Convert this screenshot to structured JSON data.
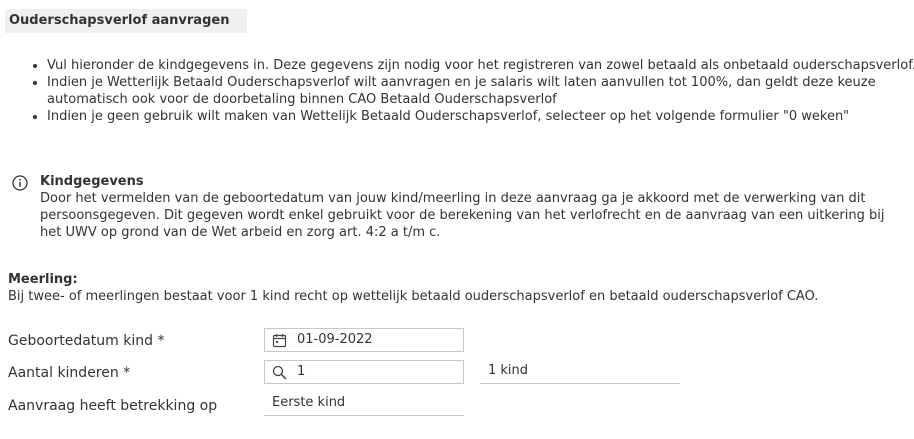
{
  "page": {
    "title": "Ouderschapsverlof aanvragen"
  },
  "intro": {
    "bullets": [
      "Vul hieronder de kindgegevens in. Deze gegevens zijn nodig voor het registreren van zowel betaald als onbetaald ouderschapsverlof.",
      "Indien je Wetterlijk Betaald Ouderschapsverlof wilt aanvragen en je salaris wilt laten aanvullen tot 100%, dan geldt deze keuze automatisch ook voor de doorbetaling binnen CAO Betaald Ouderschapsverlof",
      "Indien je geen gebruik wilt maken van Wettelijk Betaald Ouderschapsverlof, selecteer op het volgende formulier \"0 weken\""
    ]
  },
  "info": {
    "icon": "info-circle-icon",
    "title": "Kindgegevens",
    "text": "Door het vermelden van de geboortedatum van jouw kind/meerling in deze aanvraag ga je akkoord met de verwerking van dit persoonsgegeven. Dit gegeven wordt enkel gebruikt voor de berekening van het verlofrecht en de aanvraag van een uitkering bij het UWV op grond van de Wet arbeid en zorg art. 4:2 a t/m c."
  },
  "meerling": {
    "title": "Meerling:",
    "text": "Bij twee- of meerlingen bestaat voor 1 kind recht op wettelijk betaald ouderschapsverlof en betaald ouderschapsverlof CAO."
  },
  "form": {
    "birthdate": {
      "label": "Geboortedatum kind *",
      "value": "01-09-2022",
      "icon": "calendar-icon"
    },
    "children": {
      "label": "Aantal kinderen *",
      "value": "1",
      "icon": "search-icon",
      "description": "1 kind"
    },
    "relates_to": {
      "label": "Aanvraag heeft betrekking op",
      "value": "Eerste kind"
    }
  }
}
